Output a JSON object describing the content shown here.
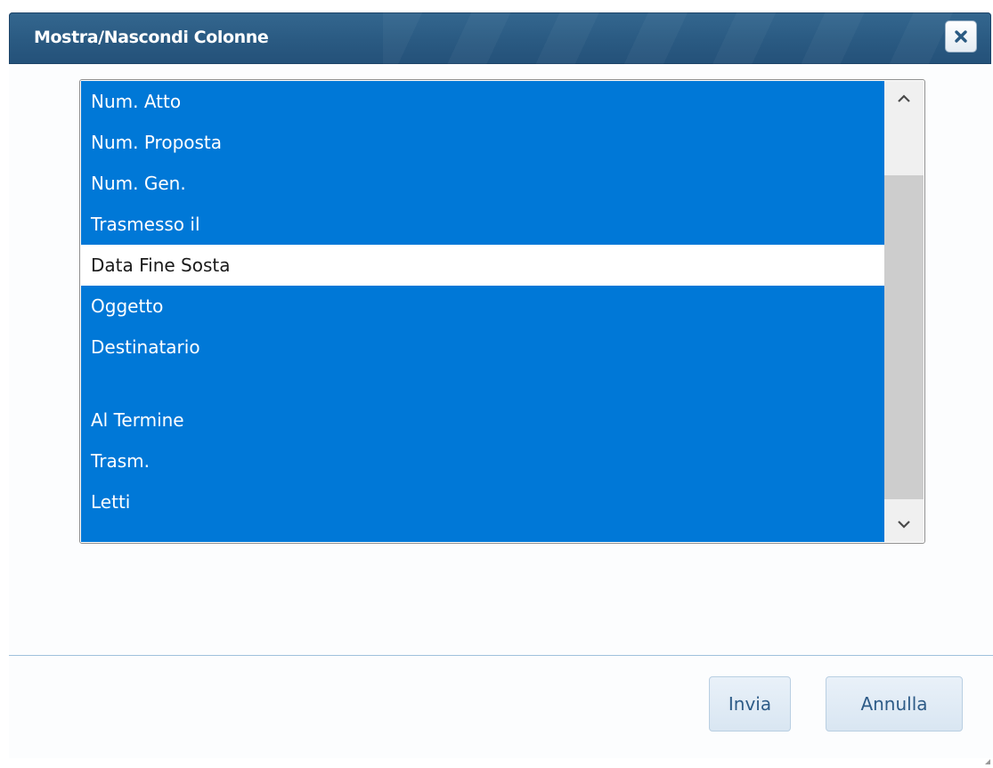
{
  "dialog": {
    "title": "Mostra/Nascondi Colonne",
    "close_icon": "close-icon",
    "accent_color": "#0078d7",
    "titlebar_color": "#2a5a82"
  },
  "listbox": {
    "options": [
      {
        "label": "Num. Atto",
        "selected": true
      },
      {
        "label": "Num. Proposta",
        "selected": true
      },
      {
        "label": "Num. Gen.",
        "selected": true
      },
      {
        "label": "Trasmesso il",
        "selected": true
      },
      {
        "label": "Data Fine Sosta",
        "selected": false
      },
      {
        "label": "Oggetto",
        "selected": true
      },
      {
        "label": "Destinatario",
        "selected": true
      },
      {
        "label": "",
        "selected": true
      },
      {
        "label": "Al Termine",
        "selected": true
      },
      {
        "label": "Trasm.",
        "selected": true
      },
      {
        "label": "Letti",
        "selected": true
      }
    ],
    "scroll_up_icon": "chevron-up-icon",
    "scroll_down_icon": "chevron-down-icon"
  },
  "footer": {
    "submit_label": "Invia",
    "cancel_label": "Annulla"
  }
}
